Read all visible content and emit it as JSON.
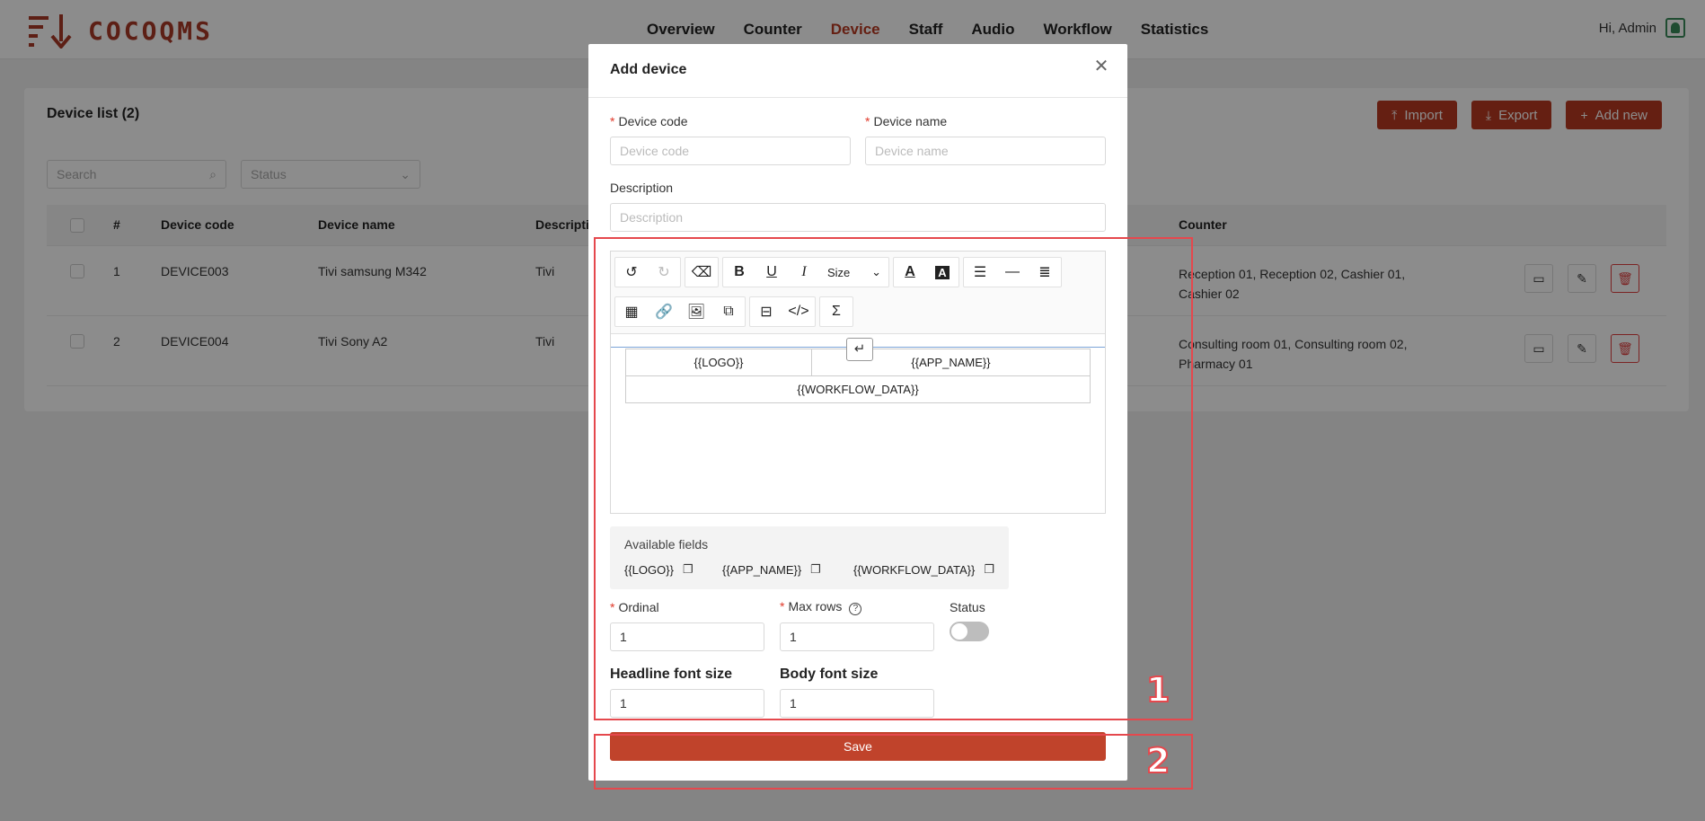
{
  "app": {
    "logo_text": "COCOQMS"
  },
  "nav": {
    "items": [
      "Overview",
      "Counter",
      "Device",
      "Staff",
      "Audio",
      "Workflow",
      "Statistics"
    ],
    "active": "Device"
  },
  "user": {
    "greeting": "Hi, Admin"
  },
  "device_list": {
    "title": "Device list (2)",
    "actions": {
      "import": "Import",
      "export": "Export",
      "add_new": "Add new"
    },
    "search_placeholder": "Search",
    "status_placeholder": "Status",
    "columns": [
      "#",
      "Device code",
      "Device name",
      "Description",
      "Counter"
    ],
    "rows": [
      {
        "index": "1",
        "code": "DEVICE003",
        "name": "Tivi samsung M342",
        "description": "Tivi",
        "counter": "Reception 01, Reception 02, Cashier 01, Cashier 02"
      },
      {
        "index": "2",
        "code": "DEVICE004",
        "name": "Tivi Sony A2",
        "description": "Tivi",
        "counter": "Consulting room 01, Consulting room 02, Pharmacy 01"
      }
    ]
  },
  "modal": {
    "title": "Add device",
    "device_code": {
      "label": "Device code",
      "placeholder": "Device code"
    },
    "device_name": {
      "label": "Device name",
      "placeholder": "Device name"
    },
    "description": {
      "label": "Description",
      "placeholder": "Description"
    },
    "editor": {
      "size_label": "Size",
      "template": {
        "logo": "{{LOGO}}",
        "app_name": "{{APP_NAME}}",
        "workflow_data": "{{WORKFLOW_DATA}}"
      }
    },
    "available_fields": {
      "title": "Available fields",
      "items": [
        "{{LOGO}}",
        "{{APP_NAME}}",
        "{{WORKFLOW_DATA}}"
      ]
    },
    "ordinal": {
      "label": "Ordinal",
      "value": "1"
    },
    "max_rows": {
      "label": "Max rows",
      "value": "1"
    },
    "status": {
      "label": "Status",
      "enabled": false
    },
    "headline_font_size": {
      "label": "Headline font size",
      "value": "1"
    },
    "body_font_size": {
      "label": "Body font size",
      "value": "1"
    },
    "save_label": "Save"
  },
  "annotations": {
    "box_1": "1",
    "box_2": "2"
  },
  "colors": {
    "brand": "#b83a22",
    "annotation": "#e5484d"
  }
}
